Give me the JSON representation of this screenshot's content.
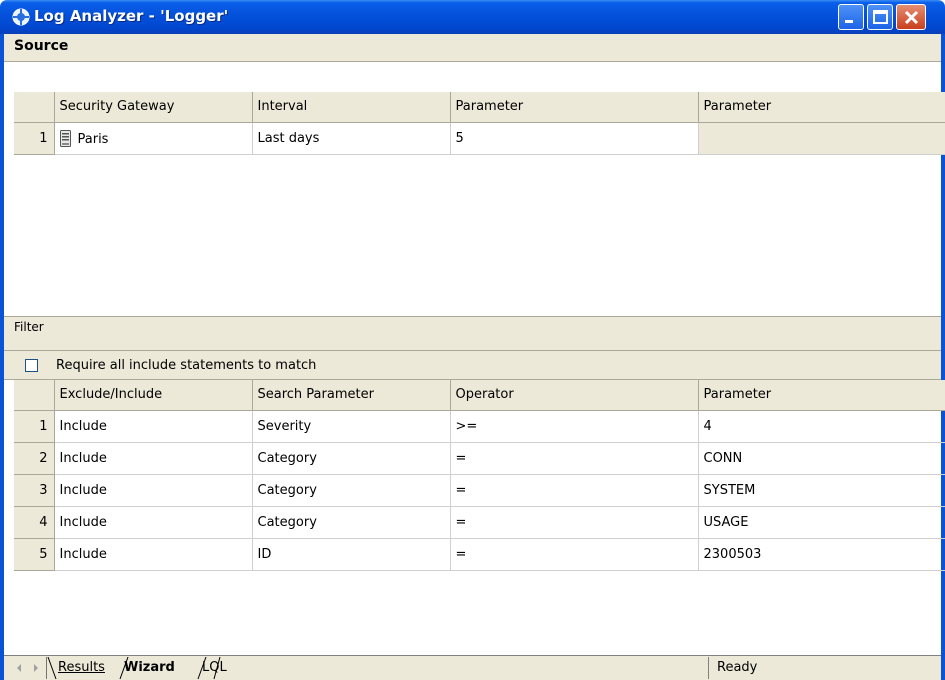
{
  "window": {
    "title": "Log Analyzer - 'Logger'",
    "icon": "log-analyzer-app-icon"
  },
  "source": {
    "section_label": "Source",
    "columns": [
      "Security Gateway",
      "Interval",
      "Parameter",
      "Parameter"
    ],
    "rows": [
      {
        "num": "1",
        "gateway": "Paris",
        "gateway_icon": "server-icon",
        "interval": "Last days",
        "param1": "5",
        "param2": ""
      }
    ]
  },
  "filter": {
    "section_label": "Filter",
    "require_all_label": "Require all include statements to match",
    "require_all_checked": false,
    "columns": [
      "Exclude/Include",
      "Search Parameter",
      "Operator",
      "Parameter"
    ],
    "rows": [
      {
        "num": "1",
        "mode": "Include",
        "search": "Severity",
        "op": ">=",
        "value": "4"
      },
      {
        "num": "2",
        "mode": "Include",
        "search": "Category",
        "op": "=",
        "value": "CONN"
      },
      {
        "num": "3",
        "mode": "Include",
        "search": "Category",
        "op": "=",
        "value": "SYSTEM"
      },
      {
        "num": "4",
        "mode": "Include",
        "search": "Category",
        "op": "=",
        "value": "USAGE"
      },
      {
        "num": "5",
        "mode": "Include",
        "search": "ID",
        "op": "=",
        "value": "2300503"
      }
    ]
  },
  "tabs": {
    "results": "Results",
    "wizard": "Wizard",
    "lql": "LQL",
    "active": "Wizard"
  },
  "status": {
    "text": "Ready"
  },
  "colors": {
    "titlebar": "#0553dd",
    "panel": "#ece9d8",
    "close_button": "#c8401e"
  }
}
